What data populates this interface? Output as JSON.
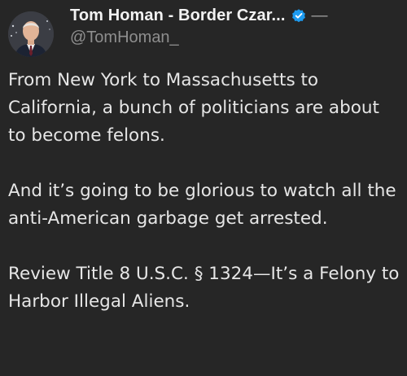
{
  "post": {
    "author": {
      "display_name": "Tom Homan - Border Czar...",
      "handle": "@TomHoman_",
      "verified": true,
      "verified_color": "#1d9bf0",
      "avatar_icon": "profile-photo"
    },
    "more_indicator": "—",
    "paragraphs": [
      "From New York to Massachusetts to California, a bunch of politicians are about to become felons.",
      "And it’s going to be glorious to watch all the anti-American garbage get arrested.",
      "Review Title 8 U.S.C. § 1324—It’s a Felony to Harbor Illegal Aliens."
    ]
  },
  "colors": {
    "background": "#262626",
    "text": "#e6e6e6",
    "handle": "#8e8e8e"
  }
}
